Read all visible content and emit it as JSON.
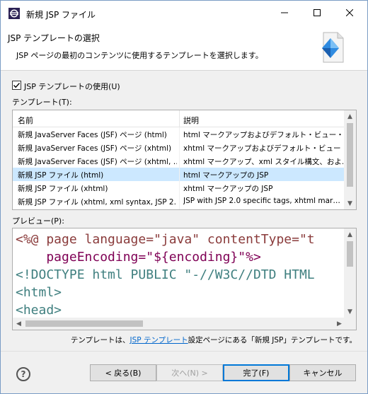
{
  "window": {
    "title": "新規 JSP ファイル",
    "icon": "eclipse-icon",
    "controls": {
      "minimize": "minimize-icon",
      "maximize": "maximize-icon",
      "close": "close-icon"
    }
  },
  "header": {
    "title": "JSP テンプレートの選択",
    "description": "JSP ページの最初のコンテンツに使用するテンプレートを選択します。",
    "icon": "jsp-wizard-icon"
  },
  "use_template": {
    "label": "JSP テンプレートの使用(U)",
    "checked": true
  },
  "templates": {
    "label": "テンプレート(T):",
    "columns": [
      "名前",
      "説明"
    ],
    "rows": [
      {
        "name": "新規 JavaServer Faces (JSF) ページ (html)",
        "desc": "html マークアップおよびデフォルト・ビュー・セッ…"
      },
      {
        "name": "新規 JavaServer Faces (JSF) ページ (xhtml)",
        "desc": "xhtml マークアップおよびデフォルト・ビュー・セッ…"
      },
      {
        "name": "新規 JavaServer Faces (JSF) ページ (xhtml, …",
        "desc": "xhtml マークアップ、xml スタイル構文、およ…"
      },
      {
        "name": "新規 JSP ファイル (html)",
        "desc": "html マークアップの JSP"
      },
      {
        "name": "新規 JSP ファイル (xhtml)",
        "desc": "xhtml マークアップの JSP"
      },
      {
        "name": "新規 JSP ファイル (xhtml, xml syntax, JSP 2.…",
        "desc": "JSP with JSP 2.0 specific tags, xhtml mar…"
      }
    ],
    "selected_index": 3
  },
  "preview": {
    "label": "プレビュー(P):",
    "lines": [
      "<%@ page language=\"java\" contentType=\"t",
      "    pageEncoding=\"${encoding}\"%>",
      "<!DOCTYPE html PUBLIC \"-//W3C//DTD HTML",
      "<html>",
      "<head>"
    ]
  },
  "note": {
    "prefix": "テンプレートは、",
    "link": "JSP テンプレート",
    "suffix": "設定ページにある「新規 JSP」テンプレートです。"
  },
  "buttons": {
    "help": "?",
    "back": "< 戻る(B)",
    "next": "次へ(N) >",
    "finish": "完了(F)",
    "cancel": "キャンセル"
  },
  "colors": {
    "selection": "#cce8ff",
    "accent": "#0078d7",
    "link": "#0066cc"
  }
}
